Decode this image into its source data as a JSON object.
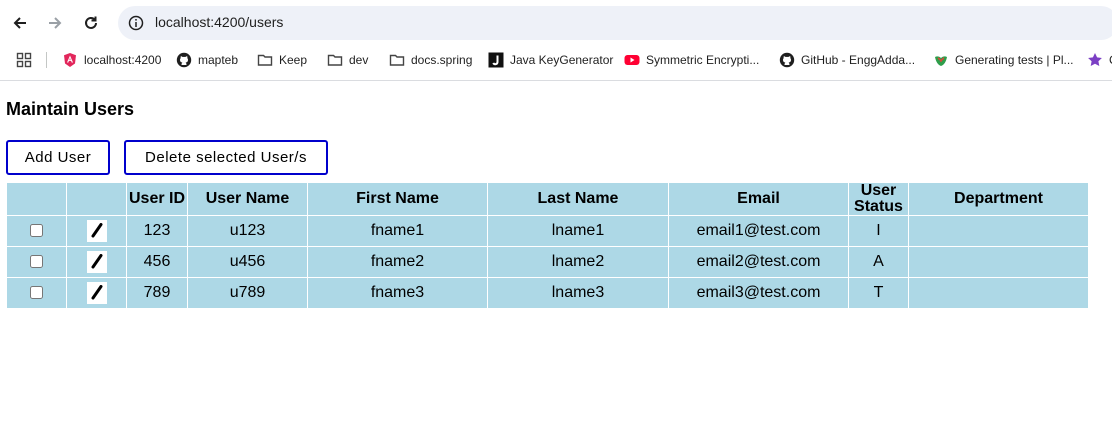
{
  "browser": {
    "url": "localhost:4200/users",
    "bookmarks": [
      {
        "label": "localhost:4200",
        "icon": "angular-icon"
      },
      {
        "label": "mapteb",
        "icon": "github-icon"
      },
      {
        "label": "Keep",
        "icon": "folder-icon"
      },
      {
        "label": "dev",
        "icon": "folder-icon"
      },
      {
        "label": "docs.spring",
        "icon": "folder-icon"
      },
      {
        "label": "Java KeyGenerator",
        "icon": "j-icon"
      },
      {
        "label": "Symmetric Encrypti...",
        "icon": "youtube-icon"
      },
      {
        "label": "GitHub - EnggAdda...",
        "icon": "github-icon"
      },
      {
        "label": "Generating tests | Pl...",
        "icon": "leaf-icon"
      },
      {
        "label": "C",
        "icon": "star-icon"
      }
    ]
  },
  "page": {
    "title": "Maintain Users",
    "add_label": "Add User",
    "delete_label": "Delete selected User/s"
  },
  "table": {
    "columns": [
      "",
      "",
      "User ID",
      "User Name",
      "First Name",
      "Last Name",
      "Email",
      "User Status",
      "Department"
    ],
    "status_header_line1": "User",
    "status_header_line2": "Status",
    "rows": [
      {
        "id": "123",
        "username": "u123",
        "first": "fname1",
        "last": "lname1",
        "email": "email1@test.com",
        "status": "I",
        "department": ""
      },
      {
        "id": "456",
        "username": "u456",
        "first": "fname2",
        "last": "lname2",
        "email": "email2@test.com",
        "status": "A",
        "department": ""
      },
      {
        "id": "789",
        "username": "u789",
        "first": "fname3",
        "last": "lname3",
        "email": "email3@test.com",
        "status": "T",
        "department": ""
      }
    ]
  },
  "colors": {
    "table_bg": "#add8e6",
    "button_border": "#0000cc",
    "omnibox_bg": "#eef1f8"
  }
}
